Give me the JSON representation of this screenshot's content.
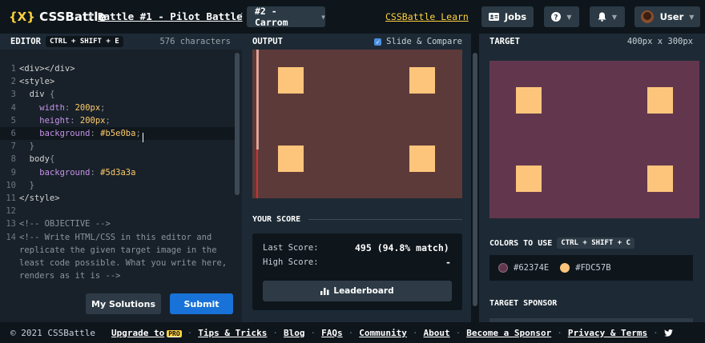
{
  "header": {
    "logo_mark": "{X}",
    "logo_text": "CSSBattle",
    "breadcrumb_battle": "Battle #1 - Pilot Battle",
    "separator": "/",
    "target_select": "#2 - Carrom",
    "learn_link": "CSSBattle Learn",
    "jobs_label": "Jobs",
    "user_label": "User"
  },
  "editor": {
    "title": "EDITOR",
    "shortcut": "CTRL + SHIFT + E",
    "char_count": "576 characters",
    "lines": [
      {
        "n": "1",
        "segments": [
          {
            "t": "<div></div>",
            "c": "tag"
          }
        ]
      },
      {
        "n": "2",
        "segments": [
          {
            "t": "<style>",
            "c": "tag"
          }
        ]
      },
      {
        "n": "3",
        "segments": [
          {
            "t": "  div ",
            "c": "tag"
          },
          {
            "t": "{",
            "c": "punc"
          }
        ]
      },
      {
        "n": "4",
        "segments": [
          {
            "t": "    width",
            "c": "prop"
          },
          {
            "t": ": ",
            "c": "punc"
          },
          {
            "t": "200px",
            "c": "num"
          },
          {
            "t": ";",
            "c": "punc"
          }
        ]
      },
      {
        "n": "5",
        "segments": [
          {
            "t": "    height",
            "c": "prop"
          },
          {
            "t": ": ",
            "c": "punc"
          },
          {
            "t": "200px",
            "c": "num"
          },
          {
            "t": ";",
            "c": "punc"
          }
        ]
      },
      {
        "n": "6",
        "segments": [
          {
            "t": "    background",
            "c": "prop"
          },
          {
            "t": ": ",
            "c": "punc"
          },
          {
            "t": "#b5e0ba",
            "c": "val"
          },
          {
            "t": ";",
            "c": "punc"
          }
        ]
      },
      {
        "n": "7",
        "segments": [
          {
            "t": "  }",
            "c": "punc"
          }
        ]
      },
      {
        "n": "8",
        "segments": [
          {
            "t": "  body",
            "c": "tag"
          },
          {
            "t": "{",
            "c": "punc"
          }
        ]
      },
      {
        "n": "9",
        "segments": [
          {
            "t": "    background",
            "c": "prop"
          },
          {
            "t": ": ",
            "c": "punc"
          },
          {
            "t": "#5d3a3a",
            "c": "val"
          }
        ]
      },
      {
        "n": "10",
        "segments": [
          {
            "t": "  }",
            "c": "punc"
          }
        ]
      },
      {
        "n": "11",
        "segments": [
          {
            "t": "</style>",
            "c": "tag"
          }
        ]
      },
      {
        "n": "12",
        "segments": []
      },
      {
        "n": "13",
        "segments": [
          {
            "t": "<!-- OBJECTIVE -->",
            "c": "cmt"
          }
        ]
      },
      {
        "n": "14",
        "segments": [
          {
            "t": "<!-- Write HTML/CSS in this editor and",
            "c": "cmt"
          }
        ]
      },
      {
        "n": "",
        "segments": [
          {
            "t": "replicate the given target image in the",
            "c": "cmt"
          }
        ]
      },
      {
        "n": "",
        "segments": [
          {
            "t": "least code possible. What you write here,",
            "c": "cmt"
          }
        ]
      },
      {
        "n": "",
        "segments": [
          {
            "t": "renders as it is -->",
            "c": "cmt"
          }
        ]
      }
    ],
    "my_solutions": "My Solutions",
    "submit": "Submit"
  },
  "output": {
    "title": "OUTPUT",
    "compare_label": "Slide & Compare",
    "compare_checked": true,
    "bg_color": "#5d3a3a",
    "square_color": "#fdc57b"
  },
  "score": {
    "title": "YOUR SCORE",
    "last_label": "Last Score:",
    "last_value": "495 (94.8% match)",
    "high_label": "High Score:",
    "high_value": "-",
    "leaderboard": "Leaderboard"
  },
  "target": {
    "title": "TARGET",
    "size": "400px x 300px",
    "bg_color": "#62374E",
    "square_color": "#FDC57B",
    "colors_title": "COLORS TO USE",
    "colors_shortcut": "CTRL + SHIFT + C",
    "colors": [
      {
        "hex": "#62374E"
      },
      {
        "hex": "#FDC57B"
      }
    ],
    "sponsor_title": "TARGET SPONSOR"
  },
  "footer": {
    "copyright": "© 2021 CSSBattle",
    "upgrade": "Upgrade to",
    "pro": "PRO",
    "links": [
      "Tips & Tricks",
      "Blog",
      "FAQs",
      "Community",
      "About",
      "Become a Sponsor",
      "Privacy & Terms"
    ]
  }
}
